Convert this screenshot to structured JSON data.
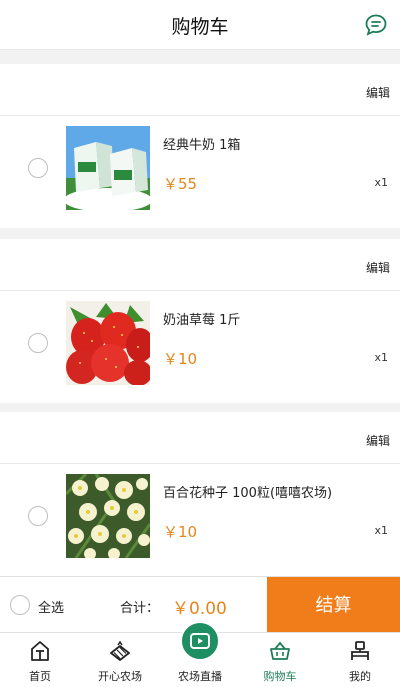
{
  "header": {
    "title": "购物车",
    "message_icon": "message-icon"
  },
  "shops": [
    {
      "edit_label": "编辑",
      "item": {
        "name": "经典牛奶  1箱",
        "price": "￥55",
        "qty": "x1",
        "image": "milk-box-image"
      }
    },
    {
      "edit_label": "编辑",
      "item": {
        "name": "奶油草莓  1斤",
        "price": "￥10",
        "qty": "x1",
        "image": "strawberry-image"
      }
    },
    {
      "edit_label": "编辑",
      "item": {
        "name": "百合花种子  100粒(嘻嘻农场)",
        "price": "￥10",
        "qty": "x1",
        "image": "lily-flowers-image"
      }
    }
  ],
  "checkout": {
    "select_all": "全选",
    "total_label": "合计：",
    "total_value": "￥0.00",
    "pay_label": "结算"
  },
  "tabs": [
    {
      "label": "首页",
      "icon": "home-icon"
    },
    {
      "label": "开心农场",
      "icon": "farm-icon"
    },
    {
      "label": "农场直播",
      "icon": "live-video-icon"
    },
    {
      "label": "购物车",
      "icon": "basket-icon"
    },
    {
      "label": "我的",
      "icon": "profile-icon"
    }
  ],
  "colors": {
    "accent_green": "#1e7d57",
    "price_orange": "#e5861c",
    "pay_button": "#f07d1a"
  }
}
